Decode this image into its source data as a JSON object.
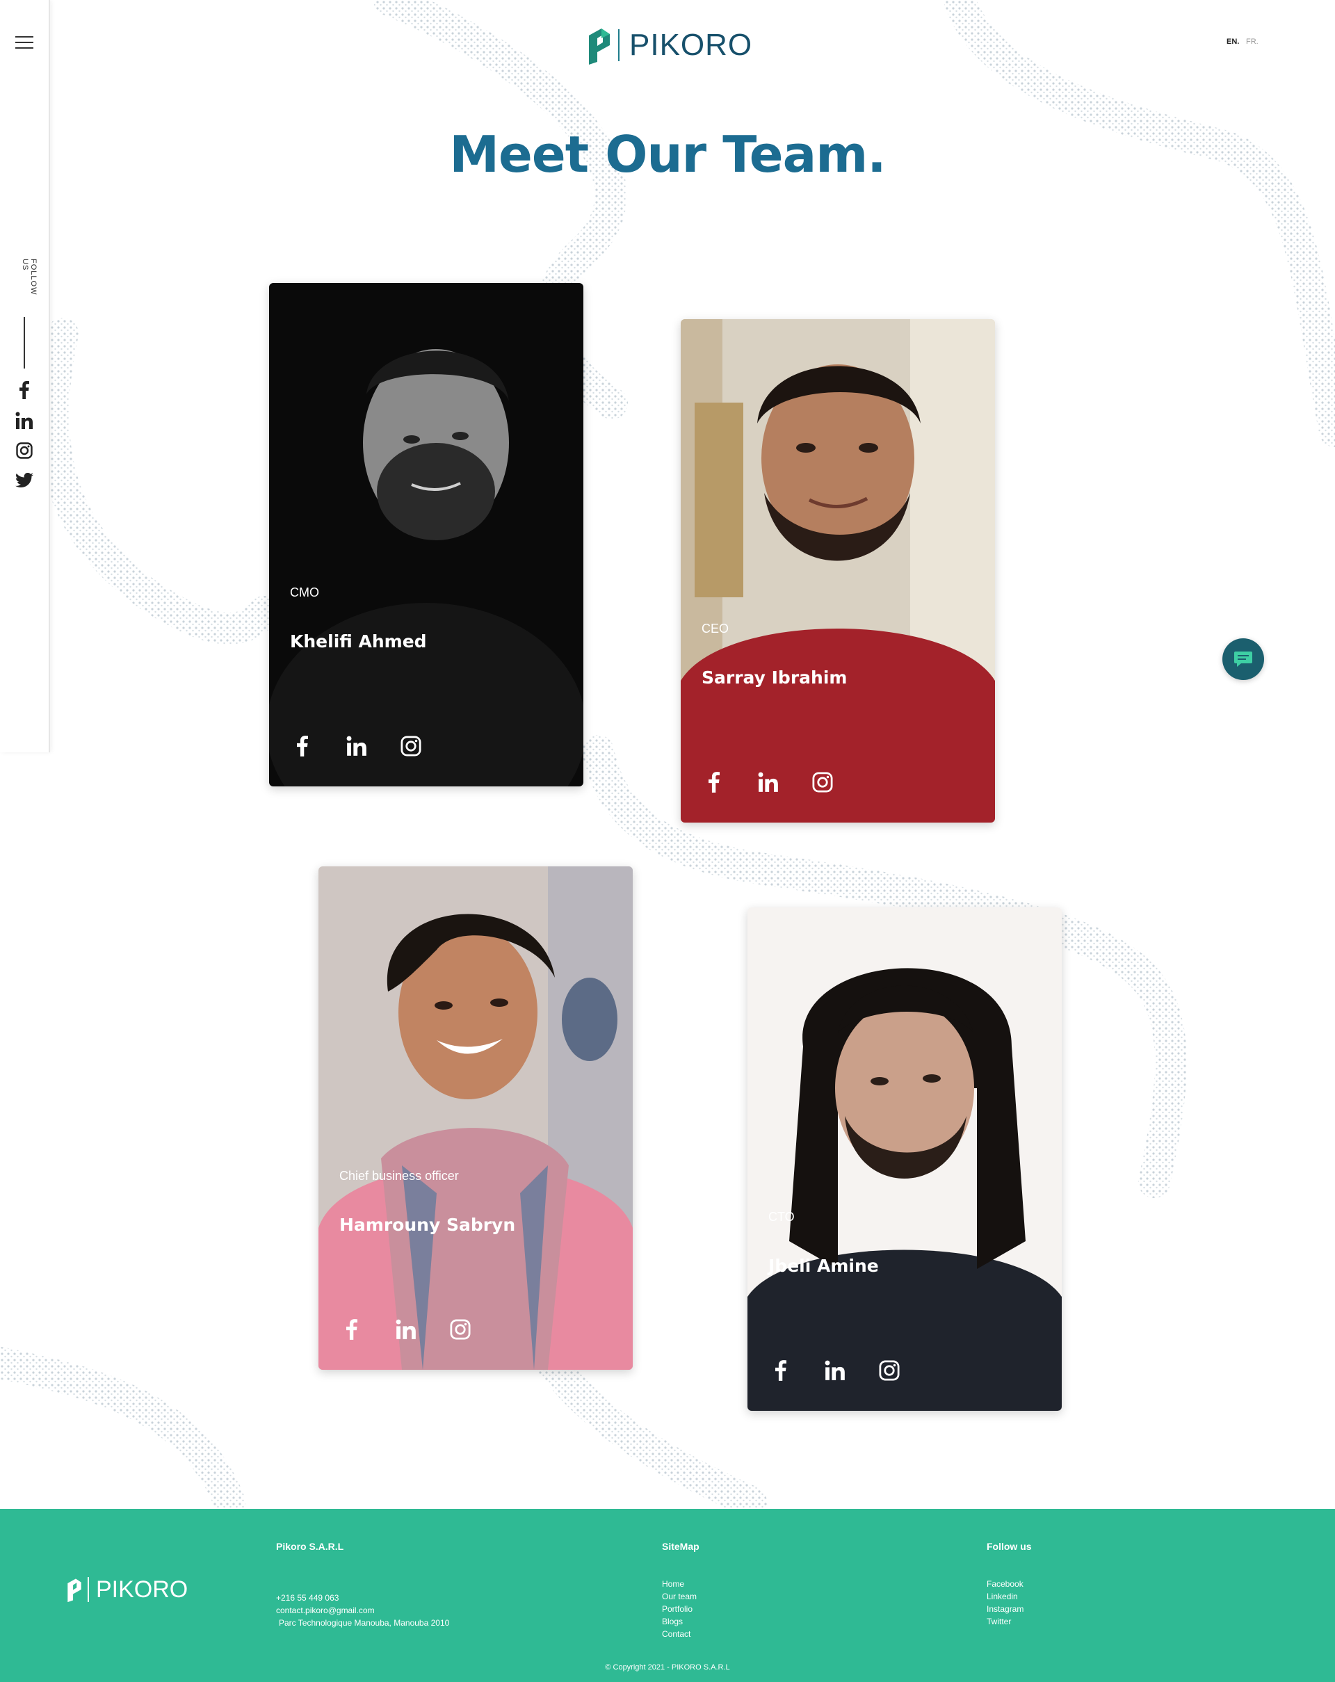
{
  "header": {
    "brand": "PIKORO",
    "lang_en": "EN.",
    "lang_fr": "FR."
  },
  "sidebar": {
    "follow_label": "FOLLOW US",
    "socials": [
      "facebook-icon",
      "linkedin-icon",
      "instagram-icon",
      "twitter-icon"
    ]
  },
  "page": {
    "title": "Meet Our Team."
  },
  "team": [
    {
      "role": "CMO",
      "name": "Khelifi Ahmed",
      "photo_tone": "#0c0c0c"
    },
    {
      "role": "CEO",
      "name": "Sarray Ibrahim",
      "photo_tone": "#a3222a"
    },
    {
      "role": "Chief business officer",
      "name": "Hamrouny Sabryn",
      "photo_tone": "#b07a78"
    },
    {
      "role": "CTO",
      "name": "Jbeli Amine",
      "photo_tone": "#22262e"
    }
  ],
  "footer": {
    "brand": "PIKORO",
    "company_heading": "Pikoro S.A.R.L",
    "phone": "+216 55 449 063",
    "email": "contact.pikoro@gmail.com",
    "address": "Parc Technologique Manouba, Manouba 2010",
    "sitemap_heading": "SiteMap",
    "sitemap": [
      "Home",
      "Our team",
      "Portfolio",
      "Blogs",
      "Contact"
    ],
    "follow_heading": "Follow us",
    "follow": [
      "Facebook",
      "Linkedin",
      "Instagram",
      "Twitter"
    ],
    "copyright": "© Copyright 2021 - PIKORO S.A.R.L"
  },
  "colors": {
    "brand_blue": "#1c6c91",
    "brand_dark": "#17506b",
    "footer_green": "#2fba94",
    "chat_teal": "#1b5f6e"
  }
}
